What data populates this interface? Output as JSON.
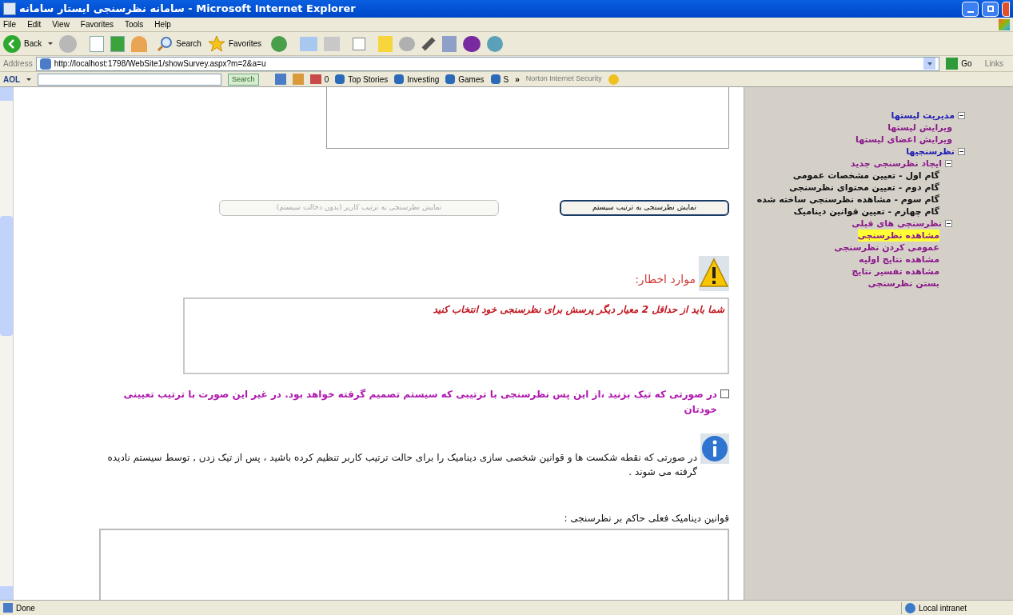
{
  "window": {
    "title": "سامانه نظرسنجی ایستار سامانه - Microsoft Internet Explorer"
  },
  "menu": {
    "file": "File",
    "edit": "Edit",
    "view": "View",
    "favorites": "Favorites",
    "tools": "Tools",
    "help": "Help"
  },
  "toolbar": {
    "back": "Back",
    "search": "Search",
    "favorites": "Favorites"
  },
  "address": {
    "label": "Address",
    "url": "http://localhost:1798/WebSite1/showSurvey.aspx?m=2&a=u",
    "go": "Go",
    "links": "Links"
  },
  "aol_bar": {
    "brand": "AOL",
    "search": "Search",
    "count": "0",
    "items": {
      "top_stories": "Top Stories",
      "investing": "Investing",
      "games": "Games",
      "item_4": "S"
    },
    "more": "»",
    "norton": "Norton Internet Security"
  },
  "page": {
    "buttons": [
      {
        "label": "نمایش نظرسنجی به ترتیب سیستم",
        "disabled": false
      },
      {
        "label": "نمایش نظرسنجی به ترتیب کاربر (بدون دخالت سیستم)",
        "disabled": true
      }
    ],
    "warning_label": "موارد اخطار:",
    "warning_text": "شما باید از حداقل 2 معیار دیگر پرسش برای نظرسنجی خود انتخاب کنید",
    "checkbox": {
      "label": "در صورتی که تیک بزنید ،از این پس نظرسنجی با ترتیبی که سیستم تصمیم گرفته خواهد بود. در غیر این صورت با ترتیب تعیینی خودتان",
      "checked": false
    },
    "info_text": "در صورتی که نقطه شکست ها و قوانین شخصی سازی دینامیک را برای حالت ترتیب کاربر تنظیم کرده باشید ، پس از تیک زدن , توسط سیستم نادیده گرفته می شوند .",
    "rules_label": "قوانین دینامیک فعلی حاکم بر نظرسنجی :"
  },
  "sidebar": {
    "items": [
      {
        "label": "مدیریت لیستها",
        "kind": "section",
        "expanded": true,
        "children": [
          {
            "label": "ویرایش لیستها",
            "kind": "link",
            "selected": false
          },
          {
            "label": "ویرایش اعضای لیستها",
            "kind": "link",
            "selected": false
          }
        ]
      },
      {
        "label": "نظرسنجیها",
        "kind": "section",
        "expanded": true,
        "children": [
          {
            "label": "ایجاد نظرسنجی جدید",
            "kind": "link",
            "expanded": true,
            "children": [
              {
                "label": "گام اول - تعیین مشخصات عمومی",
                "kind": "step",
                "selected": false
              },
              {
                "label": "گام دوم - تعیین محتوای نظرسنجی",
                "kind": "step",
                "selected": false
              },
              {
                "label": "گام سوم - مشاهده نظرسنجی ساخته شده",
                "kind": "step",
                "selected": false
              },
              {
                "label": "گام چهارم - تعیین قوانین دینامیک",
                "kind": "step",
                "selected": false
              }
            ]
          },
          {
            "label": "نظرسنجی های قبلی",
            "kind": "link",
            "expanded": true,
            "children": [
              {
                "label": "مشاهده نظرسنجی",
                "kind": "link",
                "selected": true
              },
              {
                "label": "عمومی کردن نظرسنجی",
                "kind": "link",
                "selected": false
              },
              {
                "label": "مشاهده نتایج اولیه",
                "kind": "link",
                "selected": false
              },
              {
                "label": "مشاهده تفسیر نتایج",
                "kind": "link",
                "selected": false
              },
              {
                "label": "بستن نظرسنجی",
                "kind": "link",
                "selected": false
              }
            ]
          }
        ]
      }
    ]
  },
  "status_bar": {
    "text": "Done",
    "zone": "Local intranet"
  }
}
